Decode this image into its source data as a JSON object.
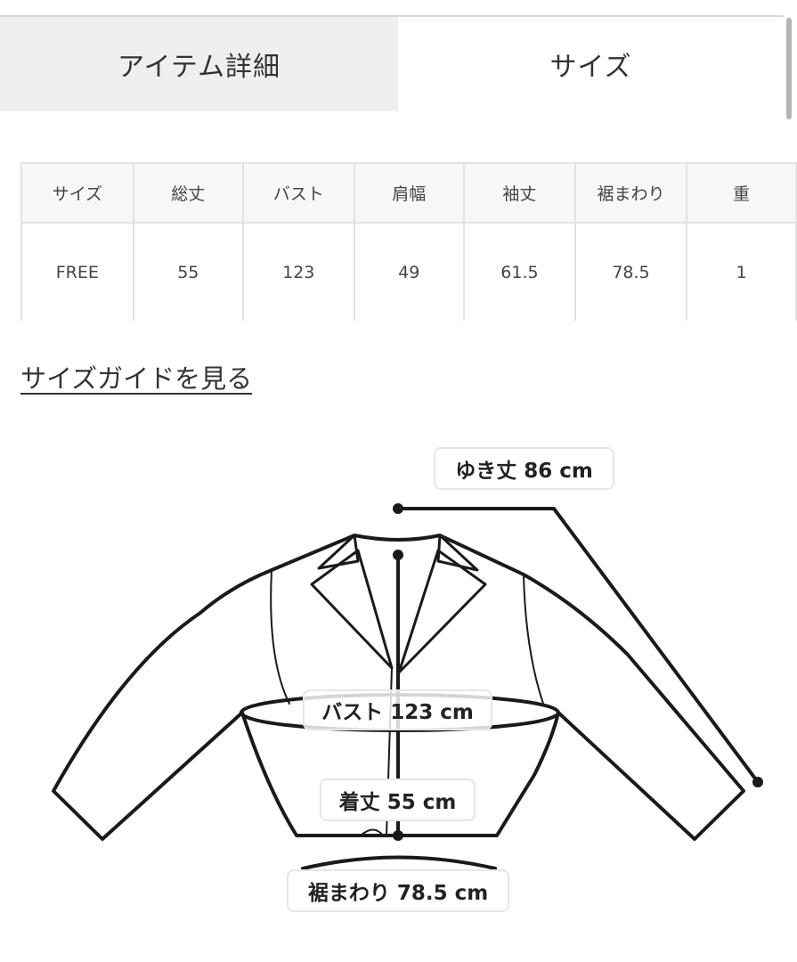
{
  "tabs": {
    "item_details": "アイテム詳細",
    "size": "サイズ"
  },
  "size_table": {
    "headers": [
      "サイズ",
      "総丈",
      "バスト",
      "肩幅",
      "袖丈",
      "裾まわり",
      "重"
    ],
    "row": [
      "FREE",
      "55",
      "123",
      "49",
      "61.5",
      "78.5",
      "1"
    ]
  },
  "size_guide_link": "サイズガイドを見る",
  "diagram": {
    "yuki_label": "ゆき丈 86 cm",
    "bust_label": "バスト 123 cm",
    "length_label": "着丈 55 cm",
    "hem_label": "裾まわり 78.5 cm"
  }
}
